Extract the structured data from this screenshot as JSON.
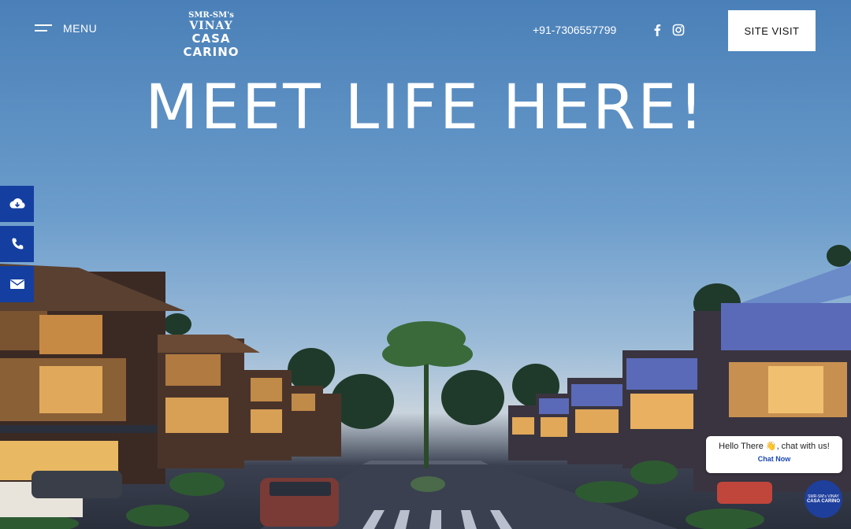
{
  "header": {
    "menu_label": "MENU",
    "logo": {
      "line1": "SMR-SM's",
      "line2": "VINAY",
      "line3": "CASA CARINO"
    },
    "phone": "+91-7306557799",
    "social": [
      "facebook-icon",
      "instagram-icon"
    ],
    "cta_label": "SITE VISIT"
  },
  "hero": {
    "title": "MEET LIFE HERE!"
  },
  "side_actions": [
    {
      "name": "download-icon"
    },
    {
      "name": "phone-icon"
    },
    {
      "name": "mail-icon"
    }
  ],
  "chat": {
    "message": "Hello There 👋, chat with us!",
    "link_label": "Chat Now",
    "widget_line1": "SMR-SM's VINAY",
    "widget_line2": "CASA CARINO"
  },
  "colors": {
    "accent": "#143fa0",
    "sky_top": "#4a80b8",
    "text_light": "#ffffff"
  }
}
